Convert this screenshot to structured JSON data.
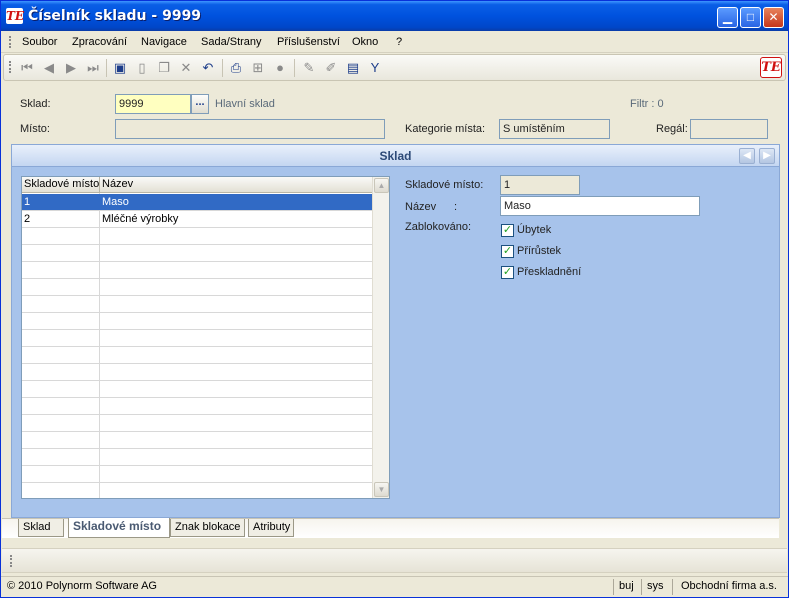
{
  "window": {
    "title": "Číselník skladu - 9999"
  },
  "menu": [
    "Soubor",
    "Zpracování",
    "Navigace",
    "Sada/Strany",
    "Příslušenství",
    "Okno",
    "?"
  ],
  "toolbar": {
    "icons": [
      "first-icon",
      "prev-icon",
      "next-icon",
      "last-icon",
      "save-icon",
      "new-icon",
      "copy-icon",
      "delete-icon",
      "undo-icon",
      "print-icon",
      "tree-icon",
      "stop-icon",
      "edit-icon",
      "pen-icon",
      "export-icon",
      "filter-icon"
    ],
    "logo": "TE"
  },
  "header": {
    "sklad_label": "Sklad:",
    "sklad_value": "9999",
    "sklad_button": "...",
    "sklad_name": "Hlavní sklad",
    "filtr": "Filtr : 0",
    "misto_label": "Místo:",
    "misto_value": "",
    "kategorie_label": "Kategorie místa:",
    "kategorie_value": "S umístěním",
    "regal_label": "Regál:",
    "regal_value": ""
  },
  "panel": {
    "title": "Sklad",
    "grid": {
      "columns": [
        "Skladové místo",
        "Název"
      ],
      "rows": [
        {
          "misto": "1",
          "nazev": "Maso",
          "selected": true
        },
        {
          "misto": "2",
          "nazev": "Mléčné výrobky",
          "selected": false
        }
      ]
    },
    "detail": {
      "misto_label": "Skladové místo:",
      "misto_value": "1",
      "nazev_label": "Název",
      "nazev_colon": ":",
      "nazev_value": "Maso",
      "zablokovano_label": "Zablokováno:",
      "checkboxes": [
        {
          "label": "Úbytek",
          "checked": true
        },
        {
          "label": "Přírůstek",
          "checked": true
        },
        {
          "label": "Přeskladnění",
          "checked": true
        }
      ]
    }
  },
  "tabs": [
    {
      "label": "Sklad",
      "active": false
    },
    {
      "label": "Skladové místo",
      "active": true
    },
    {
      "label": "Znak blokace",
      "active": false
    },
    {
      "label": "Atributy",
      "active": false
    }
  ],
  "status": {
    "copyright": "© 2010 Polynorm Software AG",
    "user": "buj",
    "system": "sys",
    "company": "Obchodní firma a.s."
  },
  "colors": {
    "title_bar": "#0052de",
    "panel_background": "#a7c3eb",
    "selection": "#316ac5",
    "input_highlight": "#ffffc0",
    "brand_red": "#d01010"
  }
}
